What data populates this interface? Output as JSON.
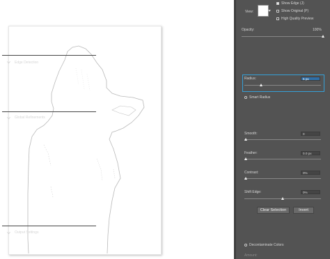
{
  "view_mode": {
    "view_label": "View:",
    "show_edge": "Show Edge (J)",
    "show_original": "Show Original (P)",
    "high_quality": "High Quality Preview"
  },
  "opacity": {
    "label": "Opacity:",
    "value": "100%",
    "level": 1.0
  },
  "edge_detection": {
    "title": "Edge Detection",
    "radius_label": "Radius:",
    "radius_value": "5 px",
    "radius_level": 0.05,
    "smart_radius": "Smart Radius"
  },
  "global_refinements": {
    "title": "Global Refinements",
    "smooth_label": "Smooth:",
    "smooth_value": "0",
    "smooth_level": 0.0,
    "feather_label": "Feather:",
    "feather_value": "0.0 px",
    "feather_level": 0.0,
    "contrast_label": "Contrast:",
    "contrast_value": "0%",
    "contrast_level": 0.0,
    "shift_label": "Shift Edge:",
    "shift_value": "0%",
    "shift_level": 0.5
  },
  "buttons": {
    "clear_selection": "Clear Selection",
    "invert": "Invert"
  },
  "output_settings": {
    "title": "Output Settings",
    "decontaminate": "Decontaminate Colors",
    "amount_label": "Amount:"
  },
  "colors": {
    "panel": "#535353",
    "accent": "#35a0d8"
  }
}
